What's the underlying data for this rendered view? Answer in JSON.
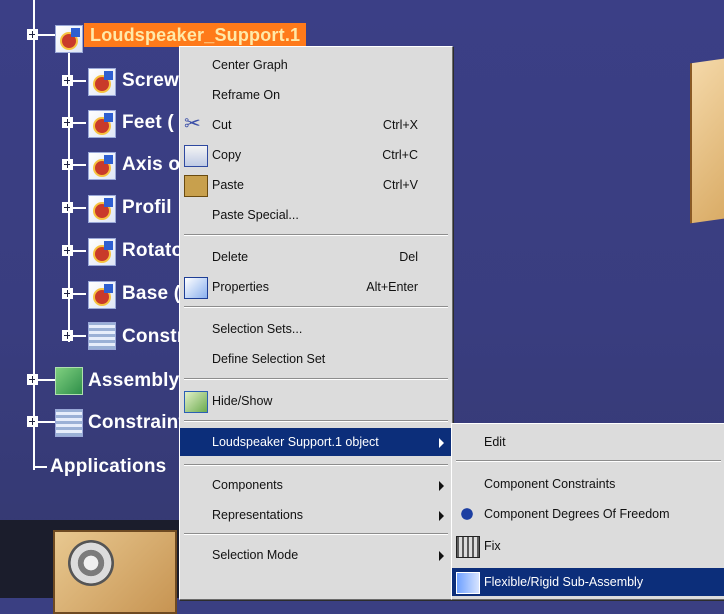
{
  "tree": {
    "root": "Loudspeaker_Support.1",
    "children": [
      "Screw",
      "Feet (",
      "Axis o",
      "Profil",
      "Rotato",
      "Base (",
      "Constr"
    ],
    "assembly": "Assembly",
    "constraints": "Constraint",
    "applications": "Applications"
  },
  "context_menu": {
    "center_graph": "Center Graph",
    "reframe_on": "Reframe On",
    "cut": "Cut",
    "cut_shortcut": "Ctrl+X",
    "copy": "Copy",
    "copy_shortcut": "Ctrl+C",
    "paste": "Paste",
    "paste_shortcut": "Ctrl+V",
    "paste_special": "Paste Special...",
    "delete": "Delete",
    "delete_shortcut": "Del",
    "properties": "Properties",
    "properties_shortcut": "Alt+Enter",
    "selection_sets": "Selection Sets...",
    "define_selection_set": "Define Selection Set",
    "hide_show": "Hide/Show",
    "object": "Loudspeaker Support.1 object",
    "components": "Components",
    "representations": "Representations",
    "selection_mode": "Selection Mode"
  },
  "submenu": {
    "edit": "Edit",
    "component_constraints": "Component Constraints",
    "component_dof": "Component Degrees Of Freedom",
    "fix": "Fix",
    "flexible_rigid": "Flexible/Rigid Sub-Assembly"
  },
  "colors": {
    "background": "#3a3f82",
    "root_highlight": "#ff7a1a",
    "menu_background": "#dcdcdc",
    "menu_highlight": "#0c2e7a"
  },
  "icons": [
    "gear-icon",
    "scissors-icon",
    "copy-icon",
    "paste-icon",
    "properties-icon",
    "hide-show-icon",
    "degrees-of-freedom-icon",
    "fix-icon",
    "flexible-rigid-icon"
  ]
}
